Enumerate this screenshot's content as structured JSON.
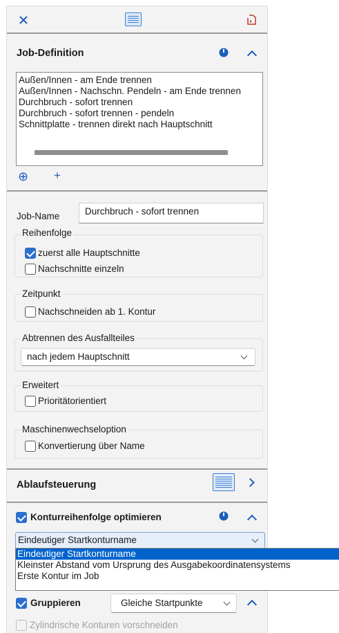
{
  "toolbar": {
    "close_icon": "close-icon",
    "table_icon": "table-view-icon",
    "export_icon": "export-icon"
  },
  "job_definition": {
    "title": "Job-Definition",
    "items": [
      "Außen/Innen - am Ende trennen",
      "Außen/Innen - Nachschn. Pendeln - am Ende trennen",
      "Durchbruch - sofort trennen",
      "Durchbruch - sofort trennen - pendeln",
      "Schnittplatte - trennen direkt nach Hauptschnitt"
    ],
    "add_circle": "⊕",
    "add_plus": "+"
  },
  "job_name": {
    "label": "Job-Name",
    "value": "Durchbruch - sofort trennen"
  },
  "reihenfolge": {
    "legend": "Reihenfolge",
    "opt1": {
      "label": "zuerst alle Hauptschnitte",
      "checked": true
    },
    "opt2": {
      "label": "Nachschnitte einzeln",
      "checked": false
    }
  },
  "zeitpunkt": {
    "legend": "Zeitpunkt",
    "opt1": {
      "label": "Nachschneiden ab 1. Kontur",
      "checked": false
    }
  },
  "abtrennen": {
    "legend": "Abtrennen des Ausfallteiles",
    "value": "nach jedem Hauptschnitt"
  },
  "erweitert": {
    "legend": "Erweitert",
    "opt1": {
      "label": "Prioritätorientiert",
      "checked": false
    }
  },
  "maschinenwechsel": {
    "legend": "Maschinenwechseloption",
    "opt1": {
      "label": "Konvertierung über Name",
      "checked": false
    }
  },
  "ablaufsteuerung": {
    "title": "Ablaufsteuerung"
  },
  "konturreihenfolge": {
    "label": "Konturreihenfolge optimieren",
    "checked": true,
    "combo_value": "Eindeutiger Startkonturname",
    "options": [
      "Eindeutiger Startkonturname",
      "Kleinster Abstand vom Ursprung des Ausgabekoordinatensystems",
      "Erste Kontur im Job"
    ]
  },
  "gruppieren": {
    "label": "Gruppieren",
    "checked": true,
    "combo_value": "Gleiche Startpunkte"
  },
  "zylindrisch": {
    "label": "Zylindrische Konturen vorschneiden",
    "checked": false,
    "disabled": true
  },
  "colors": {
    "accent": "#1c5fbd",
    "selection": "#0063cc",
    "panel_bg": "#f3f3f3"
  }
}
